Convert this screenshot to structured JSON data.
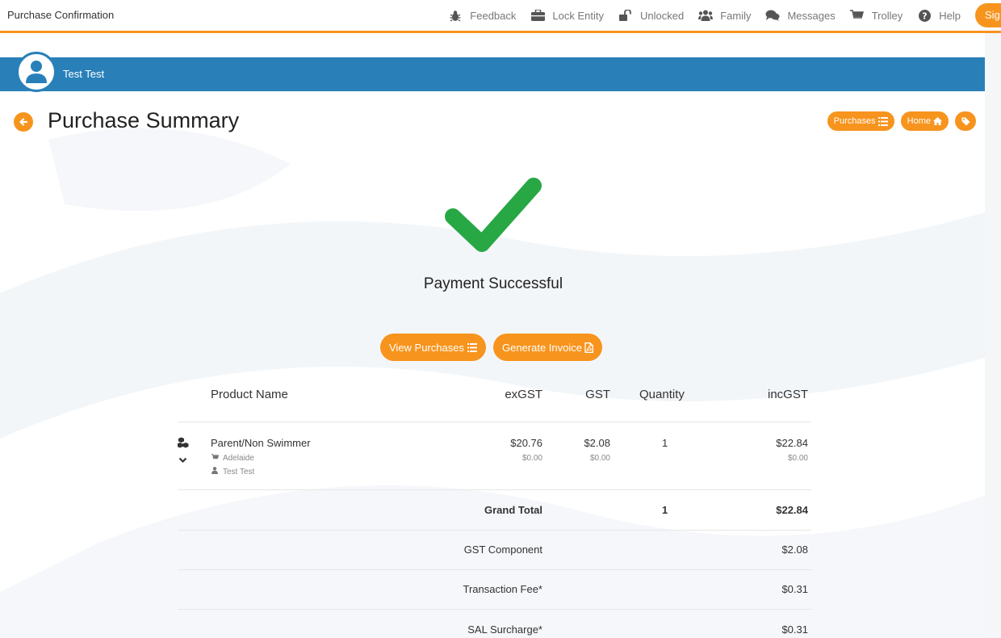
{
  "window": {
    "title": "Purchase Confirmation"
  },
  "nav": {
    "items": [
      {
        "icon": "bug-icon",
        "label": "Feedback"
      },
      {
        "icon": "briefcase-icon",
        "label": "Lock Entity"
      },
      {
        "icon": "unlock-icon",
        "label": "Unlocked"
      },
      {
        "icon": "users-icon",
        "label": "Family"
      },
      {
        "icon": "comments-icon",
        "label": "Messages"
      },
      {
        "icon": "cart-icon",
        "label": "Trolley"
      },
      {
        "icon": "question-circle-icon",
        "label": "Help"
      }
    ],
    "signin_label": "Sig"
  },
  "user": {
    "name": "Test Test"
  },
  "page": {
    "title": "Purchase Summary",
    "purchases_label": "Purchases",
    "home_label": "Home"
  },
  "success": {
    "message": "Payment Successful",
    "view_purchases_label": "View Purchases",
    "generate_invoice_label": "Generate Invoice"
  },
  "table": {
    "headers": {
      "product": "Product Name",
      "exgst": "exGST",
      "gst": "GST",
      "qty": "Quantity",
      "incgst": "incGST"
    },
    "items": [
      {
        "name": "Parent/Non Swimmer",
        "location": "Adelaide",
        "person": "Test Test",
        "exgst": "$20.76",
        "exgst_sub": "$0.00",
        "gst": "$2.08",
        "gst_sub": "$0.00",
        "qty": "1",
        "incgst": "$22.84",
        "incgst_sub": "$0.00"
      }
    ],
    "summary": {
      "grand_total_label": "Grand Total",
      "grand_total_qty": "1",
      "grand_total_value": "$22.84",
      "gst_component_label": "GST Component",
      "gst_component_value": "$2.08",
      "transaction_fee_label": "Transaction Fee*",
      "transaction_fee_value": "$0.31",
      "sal_surcharge_label": "SAL Surcharge*",
      "sal_surcharge_value": "$0.31"
    }
  },
  "colors": {
    "accent": "#f7941d",
    "userbar": "#2980b9",
    "success": "#28a745"
  }
}
